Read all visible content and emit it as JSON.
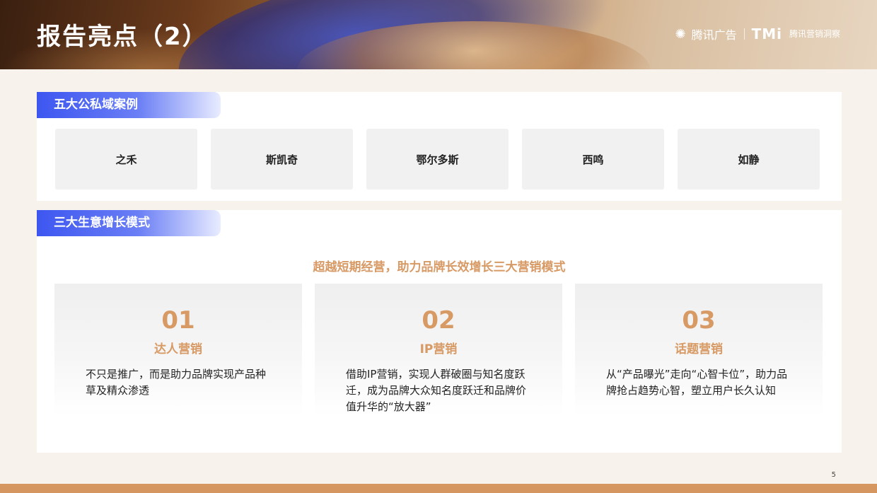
{
  "header": {
    "title": "报告亮点（2）",
    "brand_logo_mark": "✺",
    "brand_name": "腾讯广告",
    "brand_tmi": "TMi",
    "brand_tmi_text": "腾讯营销洞察"
  },
  "section1": {
    "tag": "五大公私域案例",
    "cases": [
      "之禾",
      "斯凯奇",
      "鄂尔多斯",
      "西鸣",
      "如静"
    ]
  },
  "section2": {
    "tag": "三大生意增长模式",
    "subtitle": "超越短期经营，助力品牌长效增长三大营销模式",
    "modes": [
      {
        "num": "01",
        "name": "达人营销",
        "desc": "不只是推广，而是助力品牌实现产品种草及精众渗透"
      },
      {
        "num": "02",
        "name": "IP营销",
        "desc": "借助IP营销，实现人群破圈与知名度跃迁，成为品牌大众知名度跃迁和品牌价值升华的“放大器”"
      },
      {
        "num": "03",
        "name": "话题营销",
        "desc": "从“产品曝光”走向“心智卡位”，助力品牌抢占趋势心智，塑立用户长久认知"
      }
    ]
  },
  "page_number": "5",
  "colors": {
    "accent": "#d89a65",
    "tag_blue": "#3d56f0",
    "footer": "#d6965f"
  }
}
